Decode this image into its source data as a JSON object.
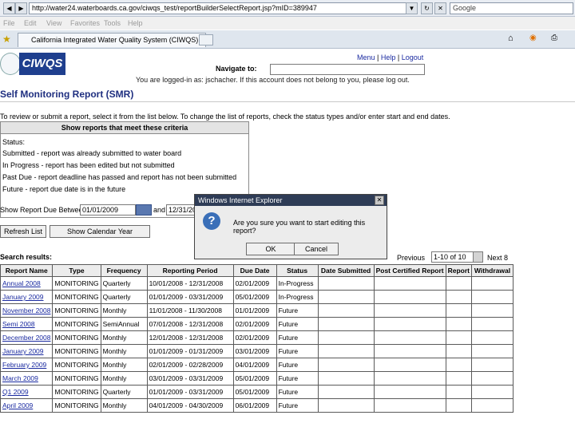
{
  "browser": {
    "url": "http://water24.waterboards.ca.gov/ciwqs_test/reportBuilderSelectReport.jsp?mID=389947",
    "search_placeholder": "Google",
    "menu": [
      "File",
      "Edit",
      "View",
      "Favorites",
      "Tools",
      "Help"
    ],
    "tab_title": "California Integrated Water Quality System (CIWQS)"
  },
  "header": {
    "logo_text": "CIWQS",
    "links": [
      "Menu",
      "Help",
      "Logout"
    ],
    "navigate_label": "Navigate to:",
    "logged_in_text": "You are logged-in as: jschacher. If this account does not belong to you, please log out."
  },
  "page": {
    "title": "Self Monitoring Report (SMR)",
    "instructions": "To review or submit a report, select it from the list below. To change the list of reports, check the status types and/or enter start and end dates."
  },
  "criteria": {
    "heading": "Show reports that meet these criteria",
    "status_label": "Status:",
    "statuses": [
      "Submitted - report was already submitted to water board",
      "In Progress - report has been edited but not submitted",
      "Past Due - report deadline has passed and report has not been submitted",
      "Future - report due date is in the future"
    ],
    "due_label": "Show Report Due Between:",
    "date_from": "01/01/2009",
    "and_label": "and",
    "date_to": "12/31/2009"
  },
  "buttons": {
    "refresh": "Refresh List",
    "calendar": "Show Calendar Year"
  },
  "results": {
    "label": "Search results:",
    "previous": "Previous",
    "page_range": "1-10 of 10",
    "next": "Next 8",
    "columns": [
      "Report Name",
      "Type",
      "Frequency",
      "Reporting Period",
      "Due Date",
      "Status",
      "Date Submitted",
      "Post Certified Report",
      "Report",
      "Withdrawal"
    ],
    "rows": [
      [
        "Annual 2008",
        "MONITORING",
        "Quarterly",
        "10/01/2008 - 12/31/2008",
        "02/01/2009",
        "In-Progress",
        "",
        "",
        "",
        ""
      ],
      [
        "January 2009",
        "MONITORING",
        "Quarterly",
        "01/01/2009 - 03/31/2009",
        "05/01/2009",
        "In-Progress",
        "",
        "",
        "",
        ""
      ],
      [
        "November 2008",
        "MONITORING",
        "Monthly",
        "11/01/2008 - 11/30/2008",
        "01/01/2009",
        "Future",
        "",
        "",
        "",
        ""
      ],
      [
        "Semi 2008",
        "MONITORING",
        "SemiAnnual",
        "07/01/2008 - 12/31/2008",
        "02/01/2009",
        "Future",
        "",
        "",
        "",
        ""
      ],
      [
        "December 2008",
        "MONITORING",
        "Monthly",
        "12/01/2008 - 12/31/2008",
        "02/01/2009",
        "Future",
        "",
        "",
        "",
        ""
      ],
      [
        "January 2009",
        "MONITORING",
        "Monthly",
        "01/01/2009 - 01/31/2009",
        "03/01/2009",
        "Future",
        "",
        "",
        "",
        ""
      ],
      [
        "February 2009",
        "MONITORING",
        "Monthly",
        "02/01/2009 - 02/28/2009",
        "04/01/2009",
        "Future",
        "",
        "",
        "",
        ""
      ],
      [
        "March 2009",
        "MONITORING",
        "Monthly",
        "03/01/2009 - 03/31/2009",
        "05/01/2009",
        "Future",
        "",
        "",
        "",
        ""
      ],
      [
        "Q1 2009",
        "MONITORING",
        "Quarterly",
        "01/01/2009 - 03/31/2009",
        "05/01/2009",
        "Future",
        "",
        "",
        "",
        ""
      ],
      [
        "April 2009",
        "MONITORING",
        "Monthly",
        "04/01/2009 - 04/30/2009",
        "06/01/2009",
        "Future",
        "",
        "",
        "",
        ""
      ]
    ]
  },
  "dialog": {
    "title": "Windows Internet Explorer",
    "icon": "question-icon",
    "message": "Are you sure you want to start editing this report?",
    "ok": "OK",
    "cancel": "Cancel"
  },
  "colors": {
    "logo_bg": "#1f3f8e",
    "title": "#1f2f80",
    "link": "#1a2aa0",
    "dialog_titlebar": "#2e3c56"
  }
}
